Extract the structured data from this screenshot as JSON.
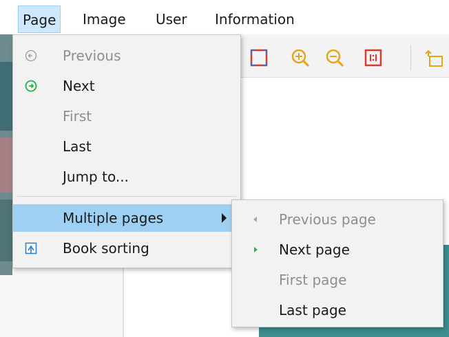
{
  "menubar": {
    "items": [
      {
        "label": "Page"
      },
      {
        "label": "Image"
      },
      {
        "label": "User"
      },
      {
        "label": "Information"
      }
    ]
  },
  "page_menu": {
    "items": [
      {
        "label": "Previous",
        "icon": "circle-arrow-left-icon",
        "enabled": false
      },
      {
        "label": "Next",
        "icon": "circle-arrow-right-icon",
        "enabled": true
      },
      {
        "label": "First",
        "enabled": false
      },
      {
        "label": "Last",
        "enabled": true
      },
      {
        "label": "Jump to...",
        "enabled": true
      },
      {
        "label": "Multiple pages",
        "has_submenu": true,
        "highlighted": true
      },
      {
        "label": "Book sorting",
        "icon": "book-sorting-icon",
        "enabled": true
      }
    ]
  },
  "multiple_pages_submenu": {
    "items": [
      {
        "label": "Previous page",
        "icon": "triangle-left-icon",
        "enabled": false
      },
      {
        "label": "Next page",
        "icon": "triangle-right-icon",
        "enabled": true
      },
      {
        "label": "First page",
        "enabled": false
      },
      {
        "label": "Last page",
        "enabled": true
      }
    ]
  },
  "colors": {
    "menu_highlight": "#9dd0f3",
    "menubar_active": "#cde8fb",
    "toolbar_icon": "#e8a317",
    "green_icon": "#23b24a",
    "teal_background": "#3e8f8f"
  }
}
